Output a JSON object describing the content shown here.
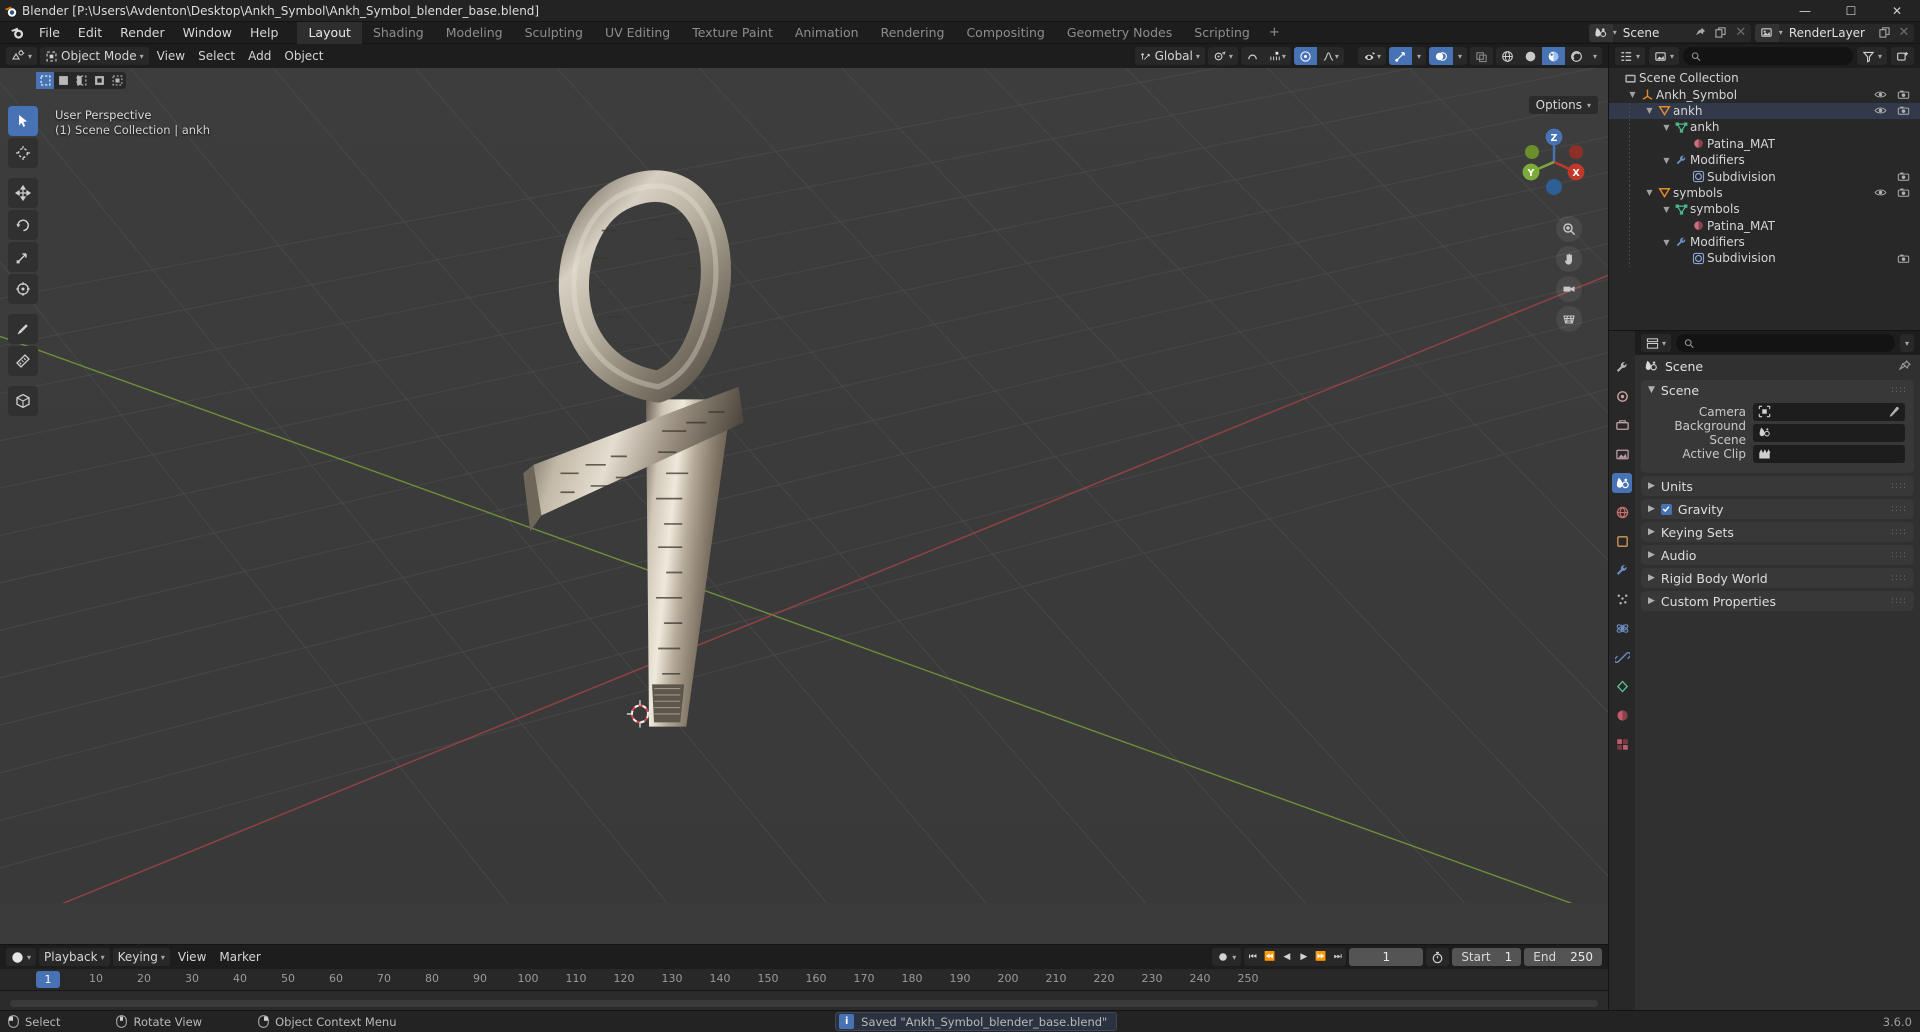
{
  "window": {
    "title": "Blender [P:\\Users\\Avdenton\\Desktop\\Ankh_Symbol\\Ankh_Symbol_blender_base.blend]",
    "minimize": "—",
    "maximize": "☐",
    "close": "✕"
  },
  "topbar": {
    "menus": [
      "File",
      "Edit",
      "Render",
      "Window",
      "Help"
    ],
    "workspaces": [
      {
        "label": "Layout",
        "active": true
      },
      {
        "label": "Shading",
        "active": false
      },
      {
        "label": "Modeling",
        "active": false
      },
      {
        "label": "Sculpting",
        "active": false
      },
      {
        "label": "UV Editing",
        "active": false
      },
      {
        "label": "Texture Paint",
        "active": false
      },
      {
        "label": "Animation",
        "active": false
      },
      {
        "label": "Rendering",
        "active": false
      },
      {
        "label": "Compositing",
        "active": false
      },
      {
        "label": "Geometry Nodes",
        "active": false
      },
      {
        "label": "Scripting",
        "active": false
      }
    ],
    "add_workspace": "+",
    "scene": {
      "name": "Scene",
      "icon": "scene-icon"
    },
    "view_layer": {
      "name": "RenderLayer",
      "icon": "view-layer-icon"
    }
  },
  "viewport": {
    "mode": "Object Mode",
    "menus": [
      "View",
      "Select",
      "Add",
      "Object"
    ],
    "transform_orientation": "Global",
    "options_label": "Options",
    "overlay_line1": "User Perspective",
    "overlay_line2": "(1) Scene Collection | ankh",
    "gizmo_axes": [
      "Z",
      "Y",
      "X"
    ],
    "tools": [
      "tweak-select-tool",
      "cursor-tool",
      "move-tool",
      "rotate-tool",
      "scale-tool",
      "transform-tool",
      "annotate-tool",
      "measure-tool",
      "add-cube-tool"
    ]
  },
  "outliner": {
    "search_placeholder": "",
    "rows": [
      {
        "label": "Scene Collection",
        "depth": 0,
        "icon": "collection-icon",
        "tri": "",
        "eye": false,
        "cam": false
      },
      {
        "label": "Ankh_Symbol",
        "depth": 1,
        "icon": "empty-axes-icon",
        "tri": "▼",
        "eye": true,
        "cam": true
      },
      {
        "label": "ankh",
        "depth": 2,
        "icon": "mesh-object-icon",
        "tri": "▼",
        "eye": true,
        "cam": true,
        "selected": true
      },
      {
        "label": "ankh",
        "depth": 3,
        "icon": "mesh-data-icon",
        "tri": "▼",
        "eye": false,
        "cam": false
      },
      {
        "label": "Patina_MAT",
        "depth": 4,
        "icon": "material-icon",
        "tri": "",
        "eye": false,
        "cam": false
      },
      {
        "label": "Modifiers",
        "depth": 3,
        "icon": "wrench-icon",
        "tri": "▼",
        "eye": false,
        "cam": false
      },
      {
        "label": "Subdivision",
        "depth": 4,
        "icon": "subdivision-icon",
        "tri": "",
        "eye": false,
        "cam": true
      },
      {
        "label": "symbols",
        "depth": 2,
        "icon": "mesh-object-icon",
        "tri": "▼",
        "eye": true,
        "cam": true
      },
      {
        "label": "symbols",
        "depth": 3,
        "icon": "mesh-data-icon",
        "tri": "▼",
        "eye": false,
        "cam": false
      },
      {
        "label": "Patina_MAT",
        "depth": 4,
        "icon": "material-icon",
        "tri": "",
        "eye": false,
        "cam": false
      },
      {
        "label": "Modifiers",
        "depth": 3,
        "icon": "wrench-icon",
        "tri": "▼",
        "eye": false,
        "cam": false
      },
      {
        "label": "Subdivision",
        "depth": 4,
        "icon": "subdivision-icon",
        "tri": "",
        "eye": false,
        "cam": true
      }
    ]
  },
  "properties": {
    "breadcrumb": "Scene",
    "panels": [
      {
        "title": "Scene",
        "open": true,
        "checkbox": false
      },
      {
        "title": "Units",
        "open": false,
        "checkbox": false
      },
      {
        "title": "Gravity",
        "open": false,
        "checkbox": true
      },
      {
        "title": "Keying Sets",
        "open": false,
        "checkbox": false
      },
      {
        "title": "Audio",
        "open": false,
        "checkbox": false
      },
      {
        "title": "Rigid Body World",
        "open": false,
        "checkbox": false
      },
      {
        "title": "Custom Properties",
        "open": false,
        "checkbox": false
      }
    ],
    "fields": [
      {
        "label": "Camera",
        "value": "",
        "icon": "camera-icon",
        "eyedropper": true
      },
      {
        "label": "Background Scene",
        "value": "",
        "icon": "scene-icon",
        "eyedropper": false
      },
      {
        "label": "Active Clip",
        "value": "",
        "icon": "clip-icon",
        "eyedropper": false
      }
    ],
    "tabs": [
      "tool-tab",
      "render-tab",
      "output-tab",
      "view-layer-tab",
      "scene-tab",
      "world-tab",
      "object-tab",
      "modifiers-tab",
      "particles-tab",
      "physics-tab",
      "constraints-tab",
      "data-tab",
      "material-tab",
      "texture-tab"
    ]
  },
  "timeline": {
    "menus": [
      "Playback",
      "Keying",
      "View",
      "Marker"
    ],
    "current_frame": "1",
    "start_label": "Start",
    "start_value": "1",
    "end_label": "End",
    "end_value": "250",
    "ticks": [
      "10",
      "20",
      "30",
      "40",
      "50",
      "60",
      "70",
      "80",
      "90",
      "100",
      "110",
      "120",
      "130",
      "140",
      "150",
      "160",
      "170",
      "180",
      "190",
      "200",
      "210",
      "220",
      "230",
      "240",
      "250"
    ],
    "playhead_frame": "1"
  },
  "statusbar": {
    "items": [
      {
        "label": "Select",
        "icon": "mouse-left-icon"
      },
      {
        "label": "Rotate View",
        "icon": "mouse-middle-icon"
      },
      {
        "label": "Object Context Menu",
        "icon": "mouse-right-icon"
      }
    ],
    "message": "Saved \"Ankh_Symbol_blender_base.blend\"",
    "version": "3.6.0"
  },
  "colors": {
    "accent": "#4772b3",
    "panel": "#303030",
    "header": "#1d1d1d",
    "viewport_bg": "#3b3b3b",
    "axis_x": "#c04040",
    "axis_y": "#7dab3a"
  }
}
